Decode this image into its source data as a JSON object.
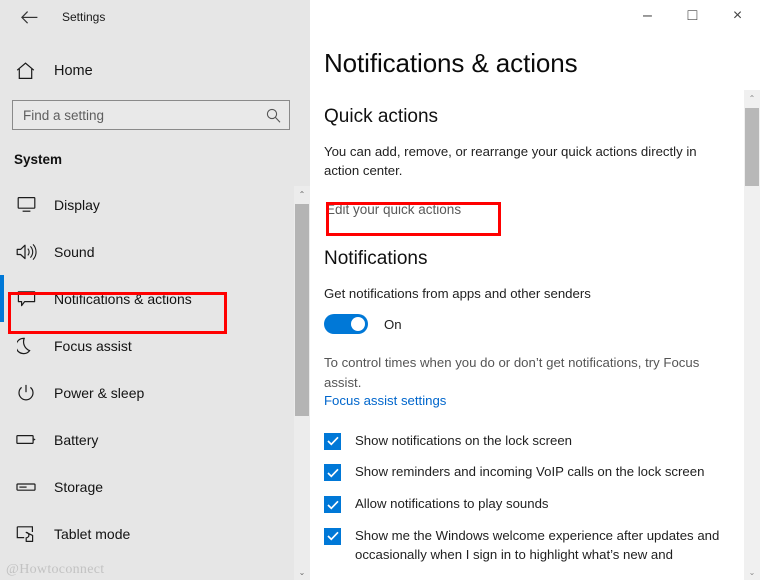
{
  "window": {
    "app_title": "Settings",
    "back_icon": "back-arrow-icon",
    "controls": {
      "minimize": "‒",
      "maximize": "□",
      "close": "×"
    }
  },
  "sidebar": {
    "home_label": "Home",
    "home_icon": "home-icon",
    "search": {
      "placeholder": "Find a setting",
      "value": "",
      "icon": "search-icon"
    },
    "section_title": "System",
    "items": [
      {
        "label": "Display",
        "icon": "monitor-icon",
        "selected": false
      },
      {
        "label": "Sound",
        "icon": "speaker-icon",
        "selected": false
      },
      {
        "label": "Notifications & actions",
        "icon": "notification-icon",
        "selected": true
      },
      {
        "label": "Focus assist",
        "icon": "moon-icon",
        "selected": false
      },
      {
        "label": "Power & sleep",
        "icon": "power-icon",
        "selected": false
      },
      {
        "label": "Battery",
        "icon": "battery-icon",
        "selected": false
      },
      {
        "label": "Storage",
        "icon": "storage-icon",
        "selected": false
      },
      {
        "label": "Tablet mode",
        "icon": "tablet-icon",
        "selected": false
      }
    ],
    "watermark": "@Howtoconnect",
    "scrollbar": {
      "up_arrow": "⌃",
      "down_arrow": "⌄"
    }
  },
  "main": {
    "page_title": "Notifications & actions",
    "quick_actions": {
      "heading": "Quick actions",
      "description": "You can add, remove, or rearrange your quick actions directly in action center.",
      "edit_link": "Edit your quick actions"
    },
    "notifications": {
      "heading": "Notifications",
      "toggle_description": "Get notifications from apps and other senders",
      "toggle_state": "On",
      "focus_text": "To control times when you do or don’t get notifications, try Focus assist.",
      "focus_link": "Focus assist settings",
      "checkboxes": [
        {
          "label": "Show notifications on the lock screen",
          "checked": true
        },
        {
          "label": "Show reminders and incoming VoIP calls on the lock screen",
          "checked": true
        },
        {
          "label": "Allow notifications to play sounds",
          "checked": true
        },
        {
          "label": "Show me the Windows welcome experience after updates and occasionally when I sign in to highlight what’s new and",
          "checked": true
        }
      ]
    },
    "scrollbar": {
      "up_arrow": "⌃",
      "down_arrow": "⌄"
    }
  },
  "colors": {
    "accent": "#0078d7",
    "link": "#0066cc",
    "annotation": "#ff0000",
    "sidebar_bg": "#e6e6e6"
  }
}
